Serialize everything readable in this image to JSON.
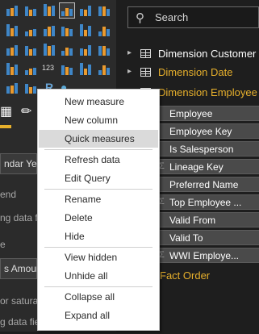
{
  "visualizations_panel": {
    "panel_labels": [
      "ndar Yea",
      "end",
      "ng data fie",
      "e",
      "s Amoun",
      "or saturat",
      "g data fie"
    ]
  },
  "fields_panel": {
    "search": {
      "placeholder": "Search"
    },
    "tables": [
      {
        "name": "Dimension Customer",
        "color": "#ffffff",
        "expanded": false
      },
      {
        "name": "Dimension Date",
        "color": "#e7b02c",
        "expanded": false
      },
      {
        "name": "Dimension Employee",
        "color": "#e7b02c",
        "expanded": true
      }
    ],
    "employee_fields": [
      {
        "name": "Employee",
        "sigma": false
      },
      {
        "name": "Employee Key",
        "sigma": false
      },
      {
        "name": "Is Salesperson",
        "sigma": false
      },
      {
        "name": "Lineage Key",
        "sigma": true
      },
      {
        "name": "Preferred Name",
        "sigma": false
      },
      {
        "name": "Top Employee ...",
        "sigma": true
      },
      {
        "name": "Valid From",
        "sigma": false
      },
      {
        "name": "Valid To",
        "sigma": false
      },
      {
        "name": "WWI Employe...",
        "sigma": true
      }
    ],
    "fact_order": {
      "name": "Fact Order",
      "color": "#e7b02c"
    }
  },
  "context_menu": {
    "groups": [
      [
        "New measure",
        "New column",
        "Quick measures"
      ],
      [
        "Refresh data",
        "Edit Query"
      ],
      [
        "Rename",
        "Delete",
        "Hide"
      ],
      [
        "View hidden",
        "Unhide all"
      ],
      [
        "Collapse all",
        "Expand all"
      ]
    ],
    "highlighted": "Quick measures"
  }
}
